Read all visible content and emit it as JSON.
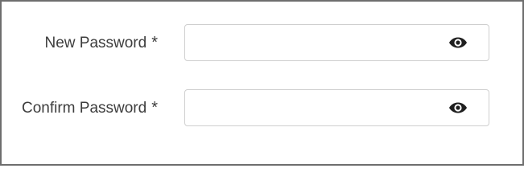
{
  "form": {
    "new_password": {
      "label": "New Password",
      "required_mark": "*",
      "value": "",
      "placeholder": "",
      "toggle_icon": "eye-icon"
    },
    "confirm_password": {
      "label": "Confirm Password",
      "required_mark": "*",
      "value": "",
      "placeholder": "",
      "toggle_icon": "eye-icon"
    }
  },
  "colors": {
    "border": "#6e6e6e",
    "input_border": "#cfcfcf",
    "label_text": "#3d3d3d",
    "icon": "#1f1f1f"
  }
}
